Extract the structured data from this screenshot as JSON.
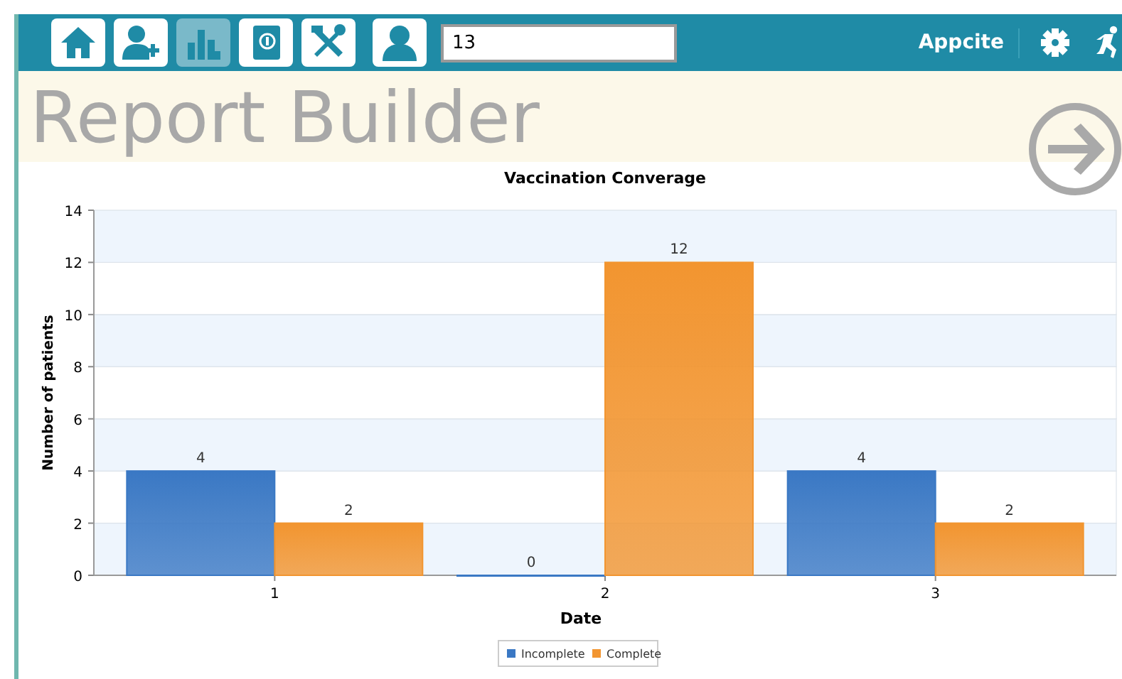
{
  "toolbar": {
    "buttons": [
      {
        "kind": "home",
        "selected": false
      },
      {
        "kind": "add-user",
        "selected": false
      },
      {
        "kind": "chart",
        "selected": true
      },
      {
        "kind": "book",
        "selected": false
      },
      {
        "kind": "tools",
        "selected": false
      },
      {
        "kind": "user",
        "selected": false
      }
    ],
    "search": {
      "value": "13"
    },
    "brand": "Appcite"
  },
  "page": {
    "title": "Report Builder"
  },
  "chart": {
    "chart_data": {
      "type": "bar",
      "title": "Vaccination Converage",
      "xlabel": "Date",
      "ylabel": "Number of patients",
      "categories": [
        "1",
        "2",
        "3"
      ],
      "series": [
        {
          "name": "Incomplete",
          "color": "#3a78c4",
          "values": [
            4,
            0,
            4
          ]
        },
        {
          "name": "Complete",
          "color": "#f29530",
          "values": [
            2,
            12,
            2
          ]
        }
      ],
      "ylim": [
        0,
        14
      ],
      "yticks": [
        0,
        2,
        4,
        6,
        8,
        10,
        12,
        14
      ],
      "data_labels": true,
      "legend": true
    }
  }
}
